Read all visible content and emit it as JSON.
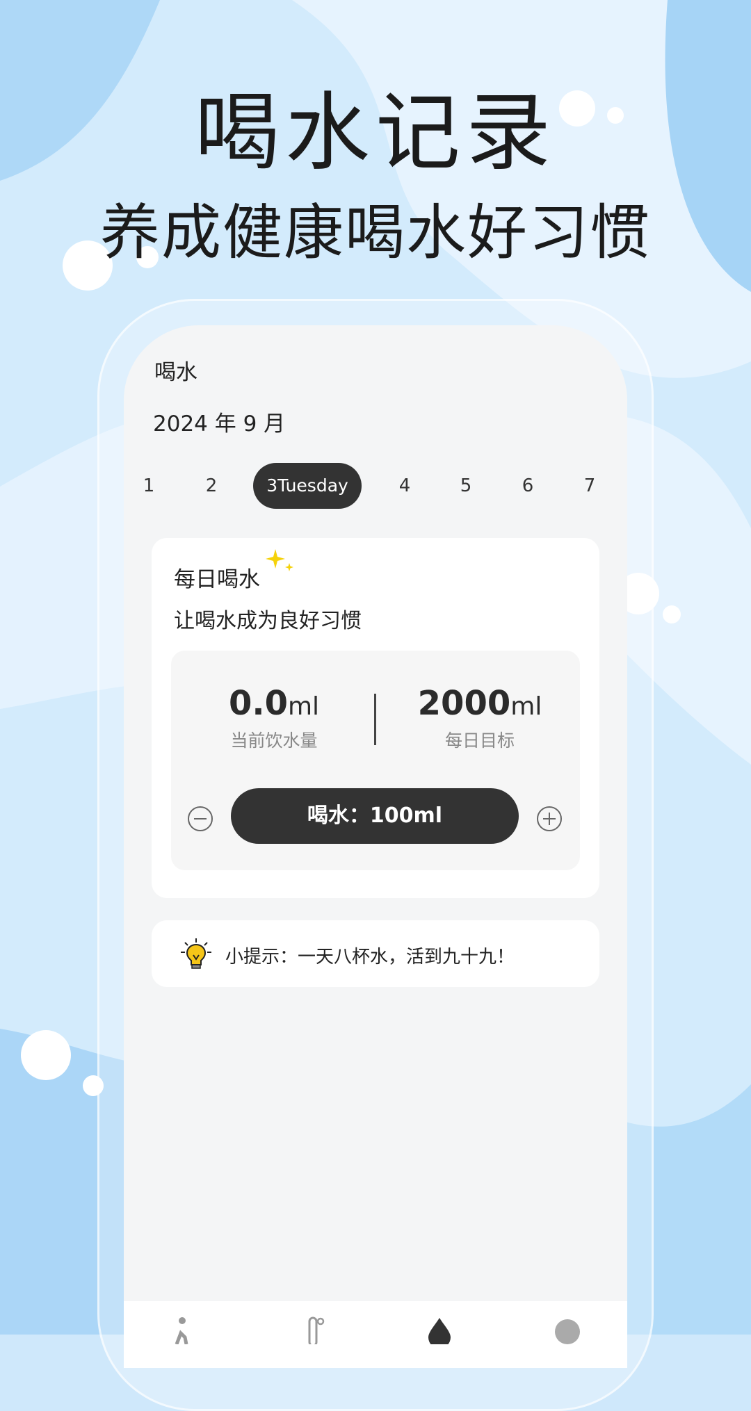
{
  "headline": {
    "title": "喝水记录",
    "subtitle": "养成健康喝水好习惯"
  },
  "app": {
    "title": "喝水",
    "month_label": "2024 年  9 月"
  },
  "days": [
    {
      "label": "1",
      "selected": false
    },
    {
      "label": "2",
      "selected": false
    },
    {
      "label": "3Tuesday",
      "selected": true
    },
    {
      "label": "4",
      "selected": false
    },
    {
      "label": "5",
      "selected": false
    },
    {
      "label": "6",
      "selected": false
    },
    {
      "label": "7",
      "selected": false
    }
  ],
  "card": {
    "title": "每日喝水",
    "subtitle": "让喝水成为良好习惯",
    "current": {
      "value": "0.0",
      "unit": "ml",
      "label": "当前饮水量"
    },
    "goal": {
      "value": "2000",
      "unit": "ml",
      "label": "每日目标"
    },
    "drink_button": "喝水：100ml"
  },
  "tip": {
    "text": "小提示：一天八杯水，活到九十九！",
    "icon": "lightbulb-icon"
  },
  "tabbar": {
    "icons": [
      "run-icon",
      "thermometer-icon",
      "water-drop-icon",
      "profile-icon"
    ]
  },
  "colors": {
    "accent_dark": "#333333",
    "background_blue": "#cfe8fb",
    "sparkle": "#f5d20a"
  }
}
